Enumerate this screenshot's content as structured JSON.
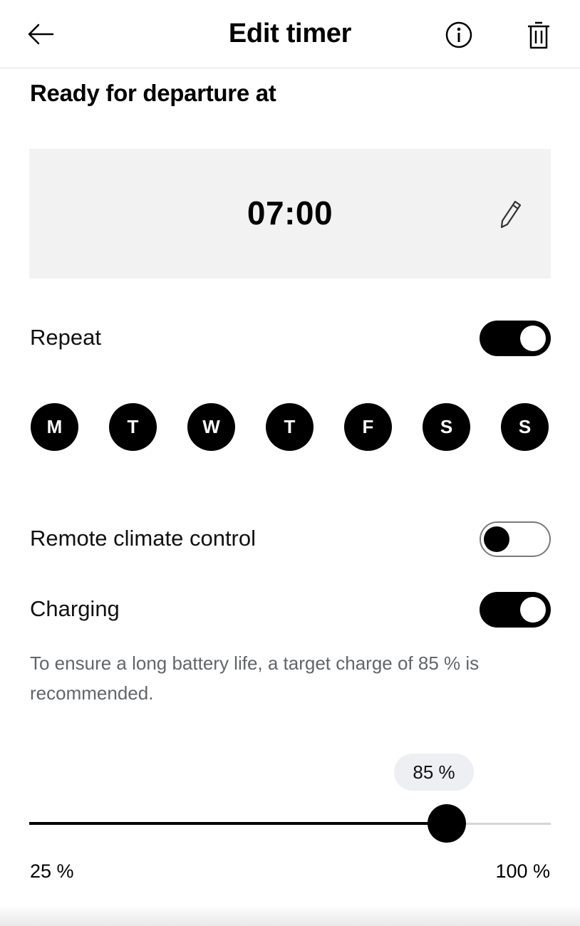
{
  "header": {
    "title": "Edit timer",
    "back_icon": "arrow-left-icon",
    "info_icon": "info-icon",
    "delete_icon": "trash-icon"
  },
  "departure": {
    "title": "Ready for departure at",
    "time": "07:00",
    "edit_icon": "pencil-icon"
  },
  "repeat": {
    "label": "Repeat",
    "enabled": true,
    "days": [
      "M",
      "T",
      "W",
      "T",
      "F",
      "S",
      "S"
    ]
  },
  "climate": {
    "label": "Remote climate control",
    "enabled": false
  },
  "charging": {
    "label": "Charging",
    "enabled": true,
    "hint": "To ensure a long battery life, a target charge of 85 % is recommended.",
    "target_label": "85 %",
    "target_value": 85,
    "min": 25,
    "max": 100,
    "min_label": "25 %",
    "max_label": "100 %"
  },
  "colors": {
    "accent": "#000000",
    "surface": "#f2f2f2",
    "hint_text": "#626669"
  }
}
